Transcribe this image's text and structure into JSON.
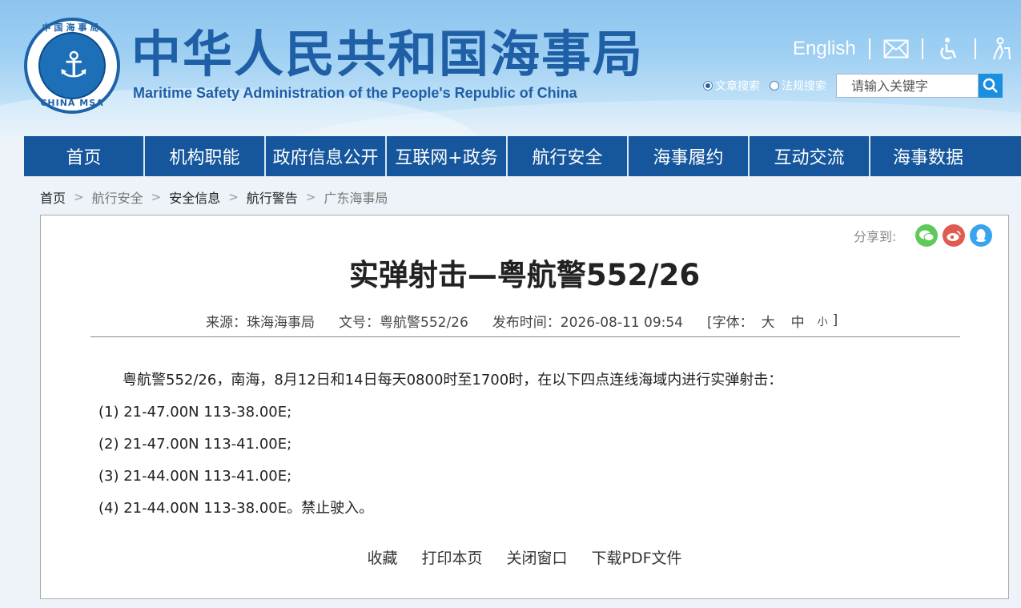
{
  "header": {
    "title": "中华人民共和国海事局",
    "subtitle": "Maritime Safety Administration of the People's Republic of China",
    "emblem_top_text": "中国海事局",
    "emblem_bottom_text": "CHINA MSA",
    "emblem_icon": "anchor-emblem",
    "english_label": "English",
    "icons": [
      "mail-icon",
      "accessibility-icon",
      "elder-care-icon"
    ],
    "search": {
      "option1": "文章搜索",
      "option2": "法规搜索",
      "placeholder": "请输入关键字",
      "button_icon": "search-icon"
    }
  },
  "nav": {
    "items": [
      "首页",
      "机构职能",
      "政府信息公开",
      "互联网+政务",
      "航行安全",
      "海事履约",
      "互动交流",
      "海事数据"
    ]
  },
  "breadcrumb": [
    "首页",
    "航行安全",
    "安全信息",
    "航行警告",
    "广东海事局"
  ],
  "article": {
    "share_label": "分享到:",
    "share_icons": [
      "wechat-icon",
      "weibo-icon",
      "qq-icon"
    ],
    "title": "实弹射击—粤航警552/26",
    "meta": {
      "source": "来源：珠海海事局",
      "doc_no": "文号：粤航警552/26",
      "publish_time": "发布时间：2026-08-11 09:54",
      "font_label": "[字体：",
      "font_big": "大",
      "font_mid": "中",
      "font_small": "小",
      "font_close": "]"
    },
    "intro": "粤航警552/26，南海，8月12日和14日每天0800时至1700时，在以下四点连线海域内进行实弹射击：",
    "points": [
      "(1)  21-47.00N 113-38.00E;",
      "(2)  21-47.00N 113-41.00E;",
      "(3)  21-44.00N 113-41.00E;",
      "(4)  21-44.00N 113-38.00E。禁止驶入。"
    ],
    "actions": [
      "收藏",
      "打印本页",
      "关闭窗口",
      "下载PDF文件"
    ]
  },
  "colors": {
    "nav_bg": "#15569c",
    "title_blue": "#1f5fa5",
    "wechat": "#5fc95a",
    "weibo": "#e05a4f",
    "qq": "#3aa3f0"
  }
}
